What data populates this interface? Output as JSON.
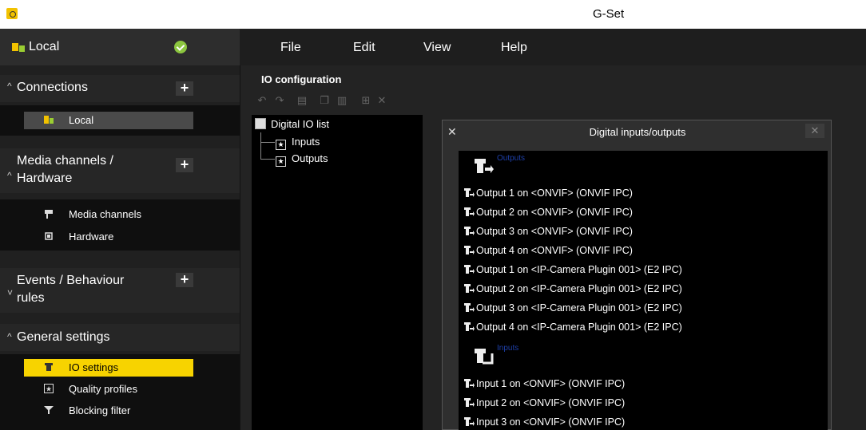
{
  "window": {
    "title": "G-Set"
  },
  "sidebar": {
    "header_label": "Local",
    "connections": {
      "label": "Connections",
      "items": [
        {
          "label": "Local"
        }
      ]
    },
    "media": {
      "label_line1": "Media channels /",
      "label_line2": "Hardware",
      "items": [
        {
          "label": "Media channels"
        },
        {
          "label": "Hardware"
        }
      ]
    },
    "events": {
      "label_line1": "Events / Behaviour",
      "label_line2": "rules"
    },
    "general": {
      "label": "General settings",
      "items": [
        {
          "label": "IO settings"
        },
        {
          "label": "Quality profiles"
        },
        {
          "label": "Blocking filter"
        }
      ]
    },
    "plus": "+"
  },
  "menubar": {
    "items": [
      {
        "label": "File"
      },
      {
        "label": "Edit"
      },
      {
        "label": "View"
      },
      {
        "label": "Help"
      }
    ]
  },
  "main": {
    "title": "IO configuration",
    "tree": {
      "root": "Digital IO list",
      "children": [
        {
          "label": "Inputs"
        },
        {
          "label": "Outputs"
        }
      ]
    }
  },
  "dialog": {
    "title": "Digital inputs/outputs",
    "close": "✕",
    "outputs_group": "Outputs",
    "inputs_group": "Inputs",
    "outputs": [
      "Output 1 on <ONVIF> (ONVIF IPC)",
      "Output 2 on <ONVIF> (ONVIF IPC)",
      "Output 3 on <ONVIF> (ONVIF IPC)",
      "Output 4 on <ONVIF> (ONVIF IPC)",
      "Output 1 on <IP-Camera Plugin 001> (E2 IPC)",
      "Output 2 on <IP-Camera Plugin 001> (E2 IPC)",
      "Output 3 on <IP-Camera Plugin 001> (E2 IPC)",
      "Output 4 on <IP-Camera Plugin 001> (E2 IPC)"
    ],
    "inputs": [
      "Input 1 on <ONVIF> (ONVIF IPC)",
      "Input 2 on <ONVIF> (ONVIF IPC)",
      "Input 3 on <ONVIF> (ONVIF IPC)"
    ]
  },
  "colors": {
    "selection": "#f7d300",
    "status_ok": "#8cc63f",
    "group_label": "#1e3fa8"
  }
}
